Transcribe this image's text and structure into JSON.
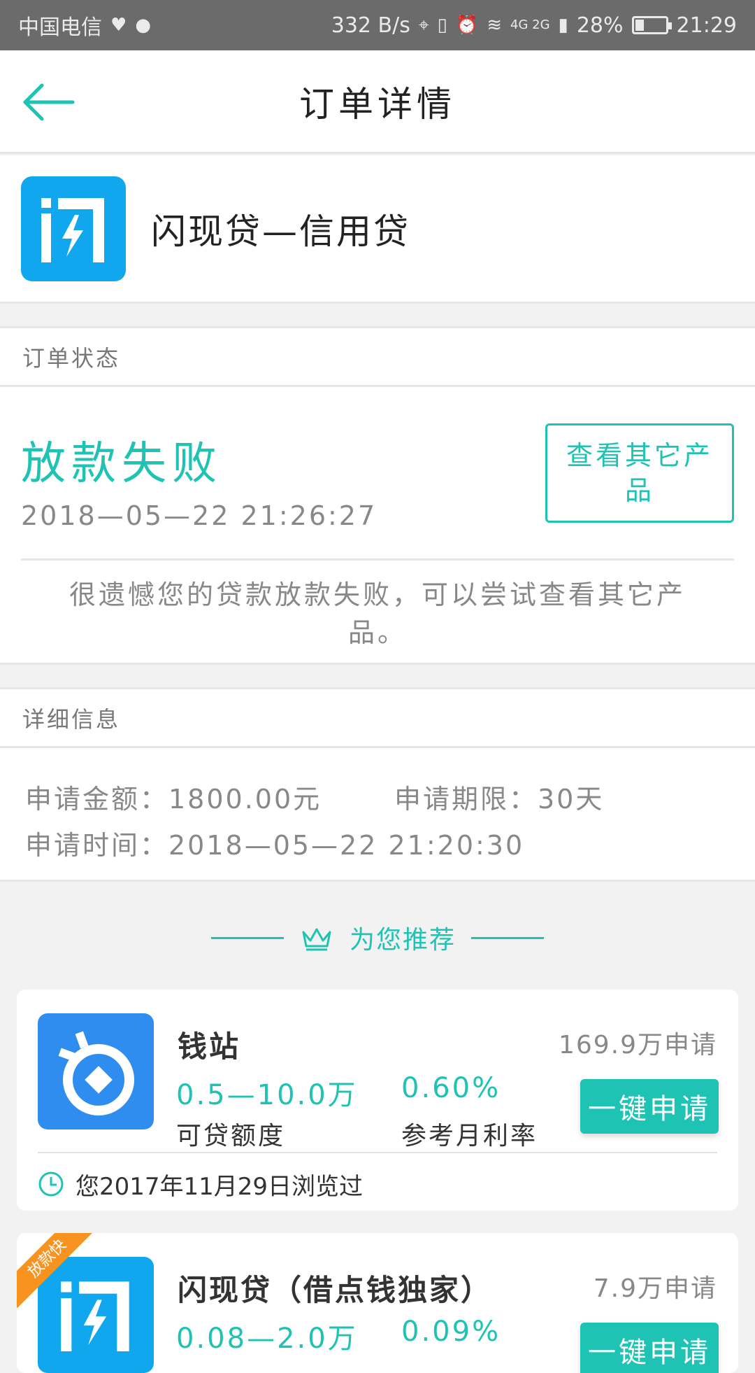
{
  "status_bar": {
    "carrier": "中国电信",
    "speed": "332 B/s",
    "network": "4G 2G",
    "battery": "28%",
    "battery_level": 0.28,
    "time": "21:29"
  },
  "nav": {
    "title": "订单详情"
  },
  "product": {
    "name": "闪现贷—信用贷",
    "logo_color": "#11a7ee"
  },
  "order_status": {
    "section_title": "订单状态",
    "status": "放款失败",
    "time": "2018—05—22 21:26:27",
    "view_other_label": "查看其它产品",
    "message": "很遗憾您的贷款放款失败，可以尝试查看其它产品。"
  },
  "details": {
    "section_title": "详细信息",
    "amount": "申请金额：1800.00元",
    "term": "申请期限：30天",
    "apply_time": "申请时间：2018—05—22 21:20:30"
  },
  "recommend": {
    "title": "为您推荐",
    "accent": "#1ec3b4",
    "cards": [
      {
        "name": "钱站",
        "applies": "169.9万申请",
        "range": "0.5—10.0万",
        "range_label": "可贷额度",
        "rate": "0.60%",
        "rate_label": "参考月利率",
        "button": "一键申请",
        "history": "您2017年11月29日浏览过",
        "logo_color": "#2f8df0"
      },
      {
        "name": "闪现贷（借点钱独家）",
        "applies": "7.9万申请",
        "range": "0.08—2.0万",
        "rate": "0.09%",
        "button": "一键申请",
        "ribbon": "放款快",
        "logo_color": "#11a7ee"
      }
    ]
  }
}
